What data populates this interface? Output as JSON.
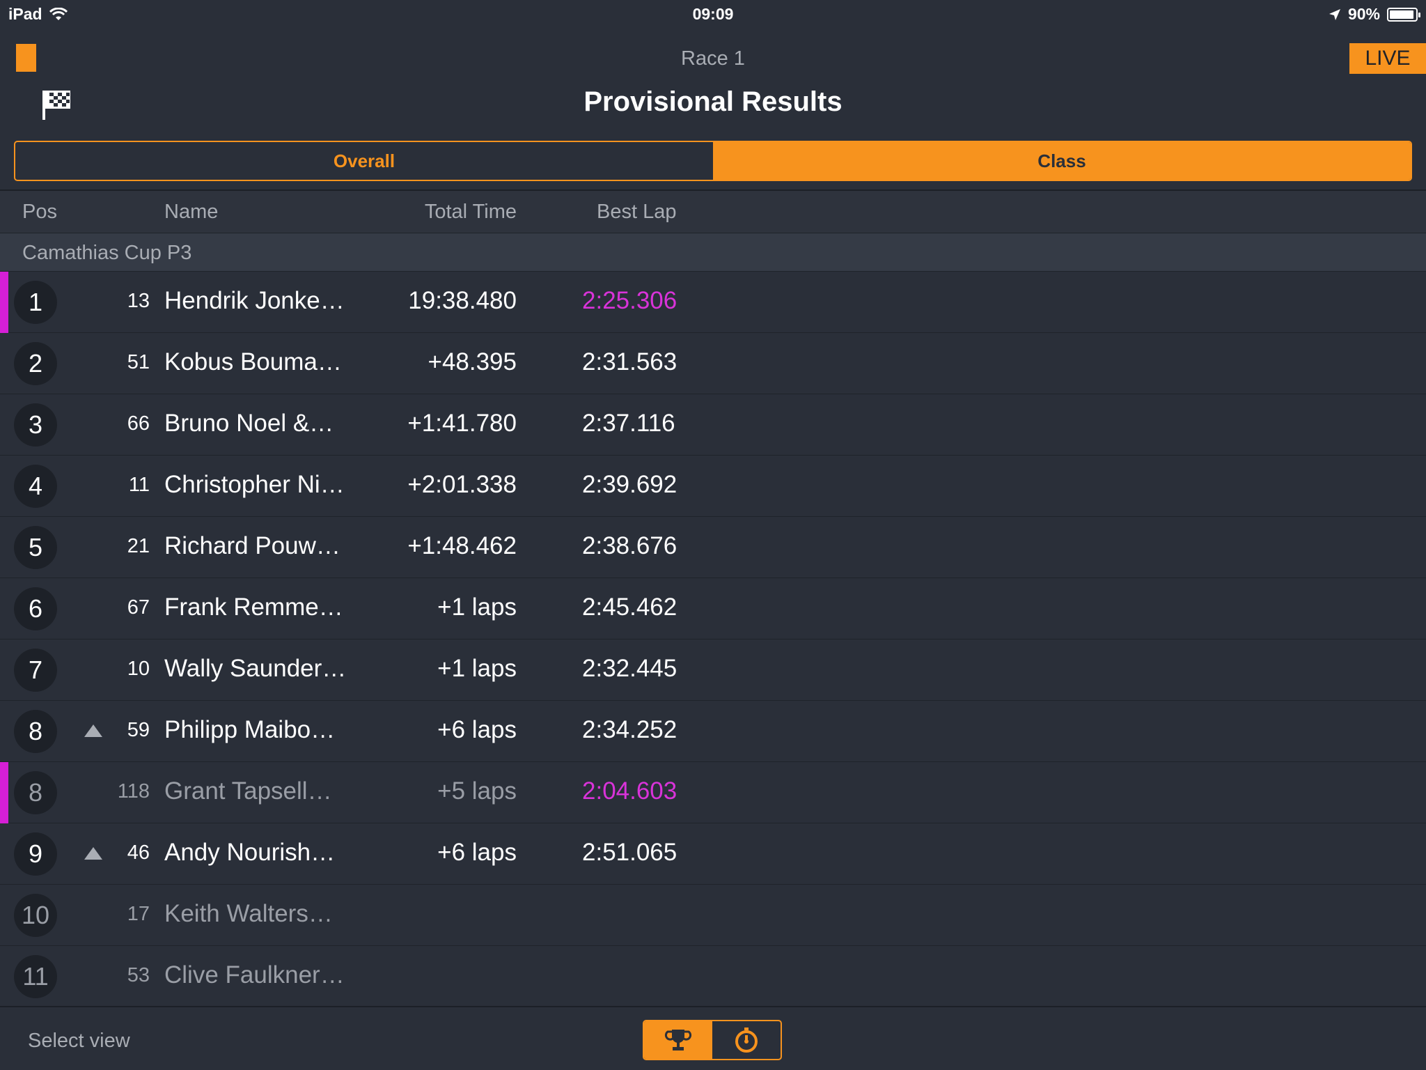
{
  "status_bar": {
    "device": "iPad",
    "time": "09:09",
    "battery": "90%",
    "icons": [
      "wifi-icon",
      "location-arrow-icon",
      "battery-icon"
    ]
  },
  "header": {
    "race_name": "Race 1",
    "live_label": "LIVE",
    "title": "Provisional Results",
    "icons": [
      "menu-tab-icon",
      "checkered-flag-icon"
    ]
  },
  "segmented": {
    "overall_label": "Overall",
    "class_label": "Class",
    "selected": "Class"
  },
  "columns": {
    "pos": "Pos",
    "name": "Name",
    "total_time": "Total Time",
    "best_lap": "Best Lap"
  },
  "group": {
    "label": "Camathias Cup P3"
  },
  "rows": [
    {
      "pos": "1",
      "num": "13",
      "name": "Hendrik Jonke…",
      "total": "19:38.480",
      "best": "2:25.306",
      "best_highlight": true,
      "marker": true,
      "arrow": false,
      "dim": false
    },
    {
      "pos": "2",
      "num": "51",
      "name": "Kobus Bouma…",
      "total": "+48.395",
      "best": "2:31.563",
      "best_highlight": false,
      "marker": false,
      "arrow": false,
      "dim": false
    },
    {
      "pos": "3",
      "num": "66",
      "name": "Bruno Noel &…",
      "total": "+1:41.780",
      "best": "2:37.116",
      "best_highlight": false,
      "marker": false,
      "arrow": false,
      "dim": false
    },
    {
      "pos": "4",
      "num": "11",
      "name": "Christopher Ni…",
      "total": "+2:01.338",
      "best": "2:39.692",
      "best_highlight": false,
      "marker": false,
      "arrow": false,
      "dim": false
    },
    {
      "pos": "5",
      "num": "21",
      "name": "Richard Pouw…",
      "total": "+1:48.462",
      "best": "2:38.676",
      "best_highlight": false,
      "marker": false,
      "arrow": false,
      "dim": false
    },
    {
      "pos": "6",
      "num": "67",
      "name": "Frank Remme…",
      "total": "+1 laps",
      "best": "2:45.462",
      "best_highlight": false,
      "marker": false,
      "arrow": false,
      "dim": false
    },
    {
      "pos": "7",
      "num": "10",
      "name": "Wally Saunder…",
      "total": "+1 laps",
      "best": "2:32.445",
      "best_highlight": false,
      "marker": false,
      "arrow": false,
      "dim": false
    },
    {
      "pos": "8",
      "num": "59",
      "name": "Philipp Maibo…",
      "total": "+6 laps",
      "best": "2:34.252",
      "best_highlight": false,
      "marker": false,
      "arrow": true,
      "dim": false
    },
    {
      "pos": "8",
      "num": "118",
      "name": "Grant Tapsell…",
      "total": "+5 laps",
      "best": "2:04.603",
      "best_highlight": true,
      "marker": true,
      "arrow": false,
      "dim": true
    },
    {
      "pos": "9",
      "num": "46",
      "name": "Andy Nourish…",
      "total": "+6 laps",
      "best": "2:51.065",
      "best_highlight": false,
      "marker": false,
      "arrow": true,
      "dim": false
    },
    {
      "pos": "10",
      "num": "17",
      "name": "Keith Walters…",
      "total": "",
      "best": "",
      "best_highlight": false,
      "marker": false,
      "arrow": false,
      "dim": true
    },
    {
      "pos": "11",
      "num": "53",
      "name": "Clive Faulkner…",
      "total": "",
      "best": "",
      "best_highlight": false,
      "marker": false,
      "arrow": false,
      "dim": true
    }
  ],
  "bottom_bar": {
    "select_view_label": "Select view",
    "views": [
      "trophy-icon",
      "stopwatch-icon"
    ],
    "selected_view": "trophy-icon"
  },
  "colors": {
    "accent": "#f7931e",
    "background": "#2a2f39",
    "fastest_lap": "#d933d9",
    "marker": "#d61fd6"
  }
}
